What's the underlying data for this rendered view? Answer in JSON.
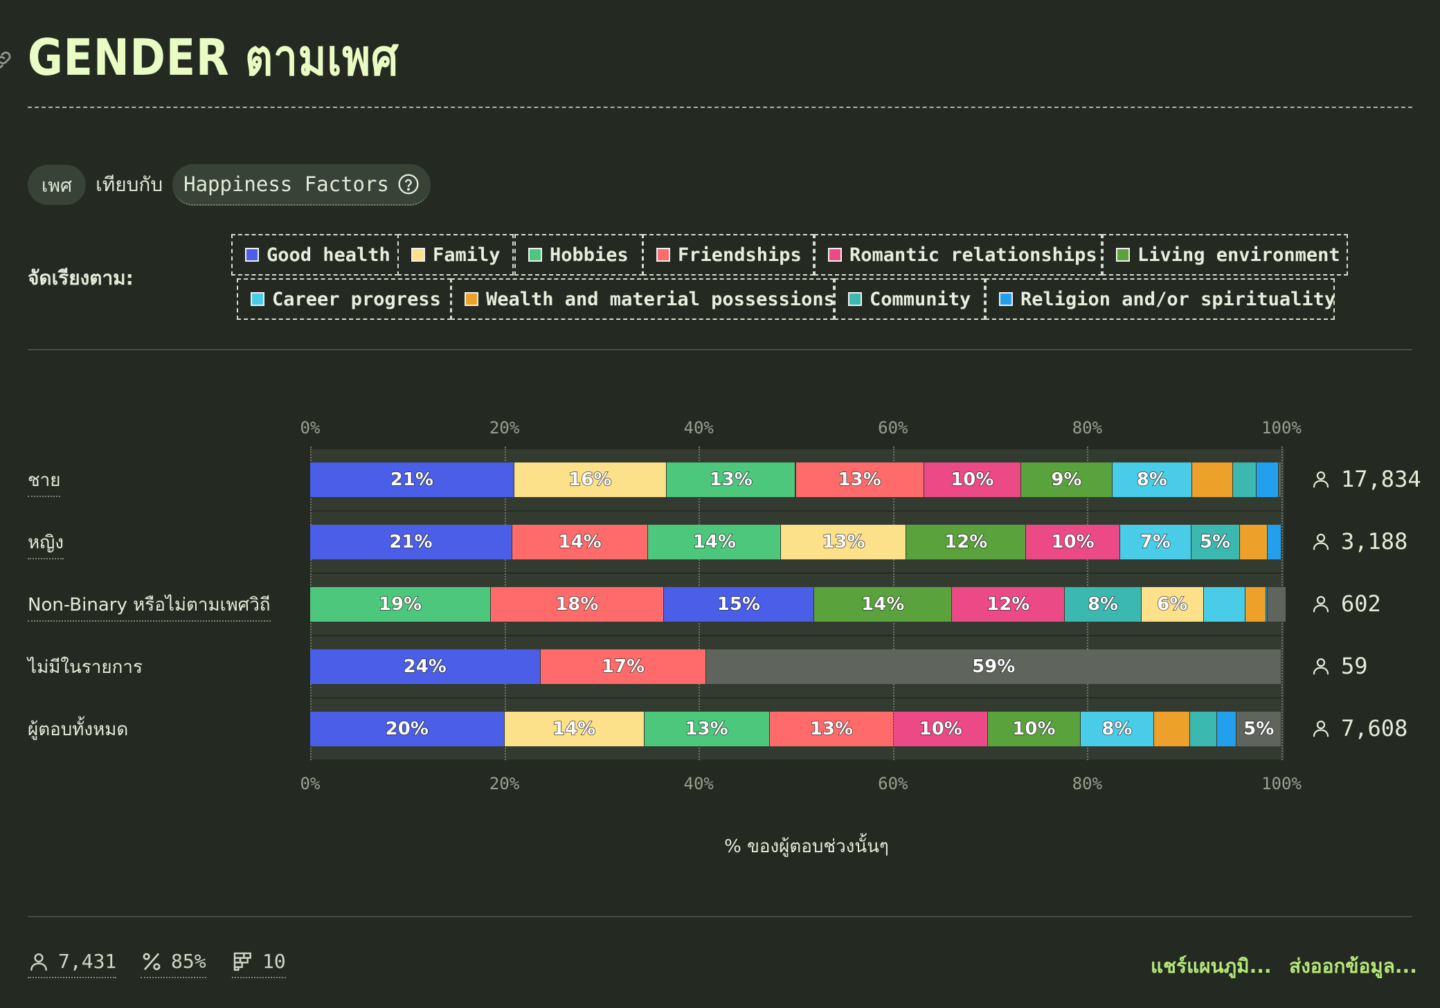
{
  "header": {
    "title": "GENDER ตามเพศ"
  },
  "filters": {
    "dimension_label": "เพศ",
    "versus_label": "เทียบกับ",
    "metric_label": "Happiness Factors"
  },
  "sort": {
    "label": "จัดเรียงตาม:"
  },
  "legend": [
    {
      "name": "Good health",
      "color": "#4a5ee8"
    },
    {
      "name": "Family",
      "color": "#fce08a"
    },
    {
      "name": "Hobbies",
      "color": "#4cc77c"
    },
    {
      "name": "Friendships",
      "color": "#ff6b6b"
    },
    {
      "name": "Romantic relationships",
      "color": "#eb4a86"
    },
    {
      "name": "Living environment",
      "color": "#5aa23c"
    },
    {
      "name": "Career progress",
      "color": "#48cce8"
    },
    {
      "name": "Wealth and material possessions",
      "color": "#eda02a"
    },
    {
      "name": "Community",
      "color": "#3bb8b0"
    },
    {
      "name": "Religion and/or spirituality",
      "color": "#22a0ee"
    }
  ],
  "chart_data": {
    "type": "bar",
    "orientation": "horizontal",
    "stacked": true,
    "xlim": [
      0,
      100
    ],
    "x_ticks": [
      "0%",
      "20%",
      "40%",
      "60%",
      "80%",
      "100%"
    ],
    "xlabel": "% ของผู้ตอบช่วงนั้นๆ",
    "other_color": "#5f645c",
    "rows": [
      {
        "label": "ชาย",
        "count": "17,834",
        "segments": [
          {
            "factor": "Good health",
            "value": 21,
            "label": "21%"
          },
          {
            "factor": "Family",
            "value": 15.7,
            "label": "16%"
          },
          {
            "factor": "Hobbies",
            "value": 13.3,
            "label": "13%"
          },
          {
            "factor": "Friendships",
            "value": 13.2,
            "label": "13%"
          },
          {
            "factor": "Romantic relationships",
            "value": 10,
            "label": "10%"
          },
          {
            "factor": "Living environment",
            "value": 9.4,
            "label": "9%"
          },
          {
            "factor": "Career progress",
            "value": 8.2,
            "label": "8%"
          },
          {
            "factor": "Wealth and material possessions",
            "value": 4.2,
            "label": ""
          },
          {
            "factor": "Community",
            "value": 2.4,
            "label": ""
          },
          {
            "factor": "Religion and/or spirituality",
            "value": 2.3,
            "label": ""
          },
          {
            "factor": "other",
            "value": 0.3,
            "label": ""
          }
        ]
      },
      {
        "label": "หญิง",
        "count": "3,188",
        "segments": [
          {
            "factor": "Good health",
            "value": 20.8,
            "label": "21%"
          },
          {
            "factor": "Friendships",
            "value": 14,
            "label": "14%"
          },
          {
            "factor": "Hobbies",
            "value": 13.7,
            "label": "14%"
          },
          {
            "factor": "Family",
            "value": 12.9,
            "label": "13%"
          },
          {
            "factor": "Living environment",
            "value": 12.3,
            "label": "12%"
          },
          {
            "factor": "Romantic relationships",
            "value": 9.7,
            "label": "10%"
          },
          {
            "factor": "Career progress",
            "value": 7.3,
            "label": "7%"
          },
          {
            "factor": "Community",
            "value": 5,
            "label": "5%"
          },
          {
            "factor": "Wealth and material possessions",
            "value": 2.9,
            "label": ""
          },
          {
            "factor": "Religion and/or spirituality",
            "value": 1.4,
            "label": ""
          }
        ]
      },
      {
        "label": "Non-Binary หรือไม่ตามเพศวิถี",
        "count": "602",
        "segments": [
          {
            "factor": "Hobbies",
            "value": 18.6,
            "label": "19%"
          },
          {
            "factor": "Friendships",
            "value": 17.8,
            "label": "18%"
          },
          {
            "factor": "Good health",
            "value": 15.5,
            "label": "15%"
          },
          {
            "factor": "Living environment",
            "value": 14.2,
            "label": "14%"
          },
          {
            "factor": "Romantic relationships",
            "value": 11.6,
            "label": "12%"
          },
          {
            "factor": "Community",
            "value": 7.9,
            "label": "8%"
          },
          {
            "factor": "Family",
            "value": 6.4,
            "label": "6%"
          },
          {
            "factor": "Career progress",
            "value": 4.3,
            "label": ""
          },
          {
            "factor": "Wealth and material possessions",
            "value": 2.1,
            "label": ""
          },
          {
            "factor": "Religion and/or spirituality",
            "value": 0.2,
            "label": ""
          },
          {
            "factor": "other",
            "value": 1.9,
            "label": ""
          }
        ]
      },
      {
        "label": "ไม่มีในรายการ",
        "count": "59",
        "segments": [
          {
            "factor": "Good health",
            "value": 23.7,
            "label": "24%"
          },
          {
            "factor": "Friendships",
            "value": 17.1,
            "label": "17%"
          },
          {
            "factor": "other",
            "value": 59.2,
            "label": "59%"
          }
        ]
      },
      {
        "label": "ผู้ตอบทั้งหมด",
        "count": "7,608",
        "segments": [
          {
            "factor": "Good health",
            "value": 20,
            "label": "20%"
          },
          {
            "factor": "Family",
            "value": 14.4,
            "label": "14%"
          },
          {
            "factor": "Hobbies",
            "value": 12.9,
            "label": "13%"
          },
          {
            "factor": "Friendships",
            "value": 12.8,
            "label": "13%"
          },
          {
            "factor": "Romantic relationships",
            "value": 9.7,
            "label": "10%"
          },
          {
            "factor": "Living environment",
            "value": 9.5,
            "label": "10%"
          },
          {
            "factor": "Career progress",
            "value": 7.6,
            "label": "8%"
          },
          {
            "factor": "Wealth and material possessions",
            "value": 3.7,
            "label": ""
          },
          {
            "factor": "Community",
            "value": 2.8,
            "label": ""
          },
          {
            "factor": "Religion and/or spirituality",
            "value": 2.0,
            "label": ""
          },
          {
            "factor": "other",
            "value": 4.6,
            "label": "5%"
          }
        ]
      }
    ]
  },
  "footer": {
    "respondents": "7,431",
    "percent": "85%",
    "factor_count": "10",
    "share_label": "แชร์แผนภูมิ...",
    "export_label": "ส่งออกข้อมูล..."
  }
}
